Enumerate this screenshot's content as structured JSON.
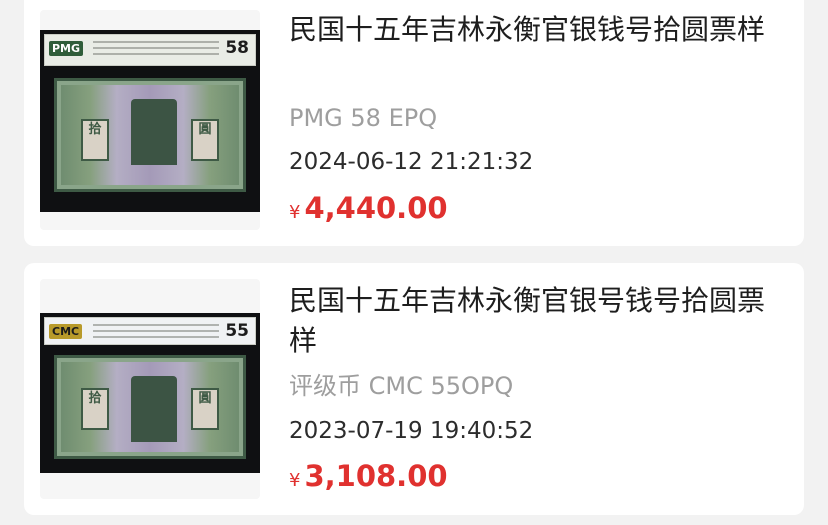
{
  "listings": [
    {
      "title": "民国十五年吉林永衡官银钱号拾圆票样",
      "grade": "PMG 58 EPQ",
      "datetime": "2024-06-12 21:21:32",
      "currency": "¥",
      "price": "4,440.00",
      "slab_logo": "PMG",
      "slab_grade": "58",
      "note_char_left": "拾",
      "note_char_right": "圓"
    },
    {
      "title": "民国十五年吉林永衡官银号钱号拾圆票样",
      "grade": "评级币 CMC 55OPQ",
      "datetime": "2023-07-19 19:40:52",
      "currency": "¥",
      "price": "3,108.00",
      "slab_logo": "CMC",
      "slab_grade": "55",
      "note_char_left": "拾",
      "note_char_right": "圓"
    }
  ],
  "colors": {
    "price": "#e0312f",
    "grade_text": "#9e9e9e",
    "title_text": "#1e1e1e",
    "page_background": "#f2f2f2"
  }
}
